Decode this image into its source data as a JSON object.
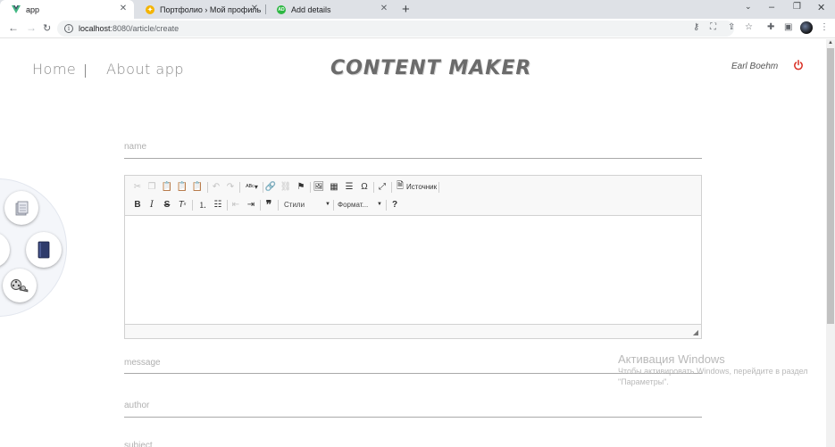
{
  "browser": {
    "tabs": [
      {
        "title": "app",
        "active": true,
        "icon": "vue-icon"
      },
      {
        "title": "Портфолио › Мой профиль",
        "active": false,
        "icon": "portfolio-icon"
      },
      {
        "title": "Add details",
        "active": false,
        "icon": "add-details-icon"
      }
    ],
    "url_host": "localhost",
    "url_path": ":8080/article/create"
  },
  "header": {
    "home_label": "Home",
    "about_label": "About app",
    "logo": "CONTENT MAKER",
    "username": "Earl Boehm"
  },
  "form": {
    "name_placeholder": "name",
    "message_placeholder": "message",
    "author_placeholder": "author",
    "subject_placeholder": "subject"
  },
  "editor": {
    "source_label": "Источник",
    "styles_label": "Стили",
    "format_label": "Формат...",
    "help_label": "?"
  },
  "watermark": {
    "title": "Активация Windows",
    "subtitle": "Чтобы активировать Windows, перейдите в раздел \"Параметры\"."
  },
  "colors": {
    "accent_power": "#d93025",
    "tab_strip": "#dee1e6"
  }
}
